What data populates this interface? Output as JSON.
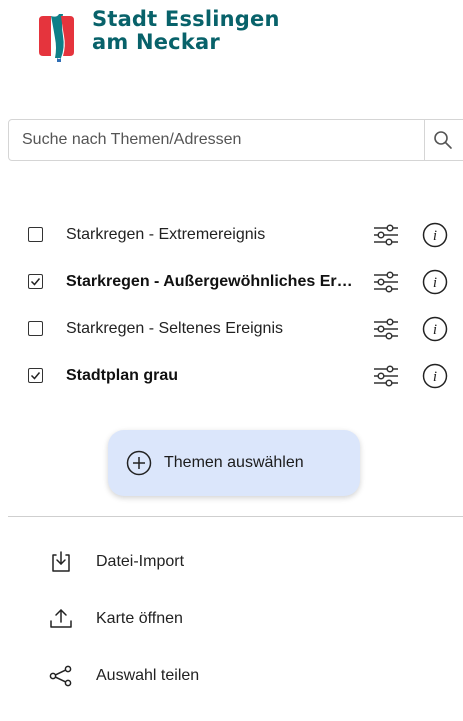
{
  "logo": {
    "line1": "Stadt Esslingen",
    "line2": "am Neckar",
    "colors": {
      "text": "#08626a",
      "red": "#e5343d",
      "teal": "#0f7f88",
      "blue": "#2f6eb5"
    }
  },
  "search": {
    "placeholder": "Suche nach Themen/Adressen",
    "value": "",
    "icon": "search-icon"
  },
  "layers": [
    {
      "label": "Starkregen - Extremereignis",
      "checked": false,
      "bold": false
    },
    {
      "label": "Starkregen - Außergewöhnliches Ereignis",
      "checked": true,
      "bold": true
    },
    {
      "label": "Starkregen - Seltenes Ereignis",
      "checked": false,
      "bold": false
    },
    {
      "label": "Stadtplan grau",
      "checked": true,
      "bold": true
    }
  ],
  "themes_button": {
    "label": "Themen auswählen",
    "icon": "plus-circle-icon",
    "color": "#dbe6fb"
  },
  "actions": [
    {
      "label": "Datei-Import",
      "icon": "file-import-icon"
    },
    {
      "label": "Karte öffnen",
      "icon": "upload-icon"
    },
    {
      "label": "Auswahl teilen",
      "icon": "share-icon"
    }
  ]
}
